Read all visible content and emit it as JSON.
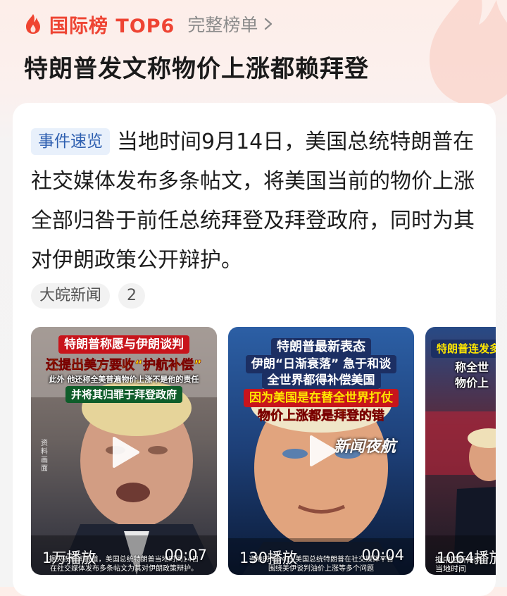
{
  "header": {
    "rank_title": "国际榜 TOP6",
    "full_list_link": "完整榜单",
    "headline": "特朗普发文称物价上涨都赖拜登"
  },
  "card": {
    "tag": "事件速览",
    "summary": "当地时间9月14日，美国总统特朗普在社交媒体发布多条帖文，将美国当前的物价上涨全部归咎于前任总统拜登及拜登政府，同时为其对伊朗政策公开辩护。",
    "source": "大皖新闻",
    "source_count": "2"
  },
  "videos": [
    {
      "cap_red": "特朗普称愿与伊朗谈判",
      "cap_yellow": "还提出美方要收“护航补偿”",
      "cap_small": "此外 他还称全美普遍物价上涨不是他的责任",
      "cap_green": "并将其归罪于拜登政府",
      "vertical_source": "资料画面",
      "views": "1万播放",
      "duration": "00:07",
      "bottom_caption_1": "据央视新闻报道，美国总统特朗普当地时间14日",
      "bottom_caption_2": "在社交媒体发布多条帖文为其对伊朗政策辩护。"
    },
    {
      "cap_red": "特朗普最新表态",
      "cap_white": "伊朗“日渐衰落”  急于和谈",
      "cap_yellow1": "全世界都得补偿美国",
      "cap_yellow2": "因为美国是在替全世界打仗",
      "cap_yellow3": "物价上涨都是拜登的错",
      "logo": "新闻夜航",
      "views": "130播放",
      "duration": "00:04",
      "bottom_caption_1": "当地时间14日 美国总统特朗普在社交媒体平台",
      "bottom_caption_2": "围绕美伊谈判油价上涨等多个问题"
    },
    {
      "cap_red": "特朗普连发多",
      "cap_white1": "称全世",
      "cap_white2": "物价上",
      "views": "1064播放",
      "bottom_caption_1": "据中国新闻网",
      "bottom_caption_2": "当地时间"
    }
  ]
}
